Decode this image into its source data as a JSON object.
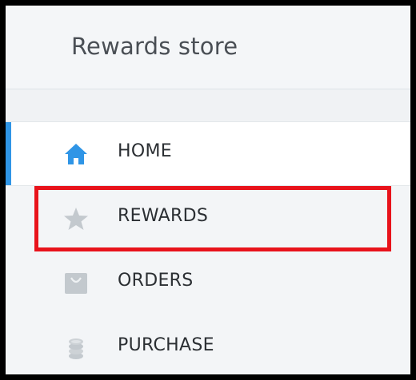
{
  "app": {
    "title": "Rewards store"
  },
  "nav": {
    "items": [
      {
        "label": "HOME",
        "icon": "home-icon",
        "active": true
      },
      {
        "label": "REWARDS",
        "icon": "star-icon",
        "active": false,
        "highlighted": true
      },
      {
        "label": "ORDERS",
        "icon": "shopping-bag-icon",
        "active": false
      },
      {
        "label": "PURCHASE",
        "icon": "coin-stack-icon",
        "active": false
      }
    ]
  },
  "colors": {
    "accent": "#2f95e6",
    "highlight_border": "#e8131b",
    "icon_inactive": "#c3c9ce",
    "text": "#2b2f33"
  }
}
